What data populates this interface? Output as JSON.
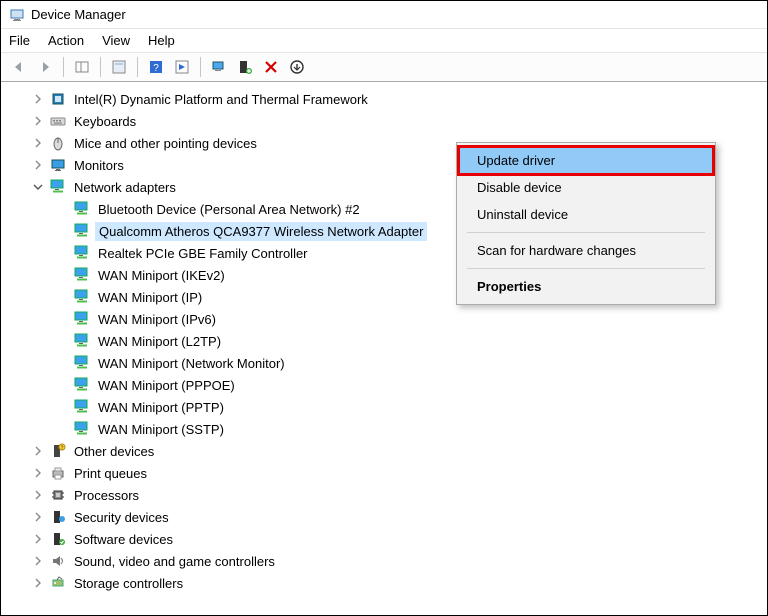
{
  "window": {
    "title": "Device Manager"
  },
  "menu": {
    "file": "File",
    "action": "Action",
    "view": "View",
    "help": "Help"
  },
  "tree": {
    "items": [
      {
        "expand": "closed",
        "icon": "intel",
        "label": "Intel(R) Dynamic Platform and Thermal Framework",
        "depth": 1
      },
      {
        "expand": "closed",
        "icon": "keyboard",
        "label": "Keyboards",
        "depth": 1
      },
      {
        "expand": "closed",
        "icon": "mouse",
        "label": "Mice and other pointing devices",
        "depth": 1
      },
      {
        "expand": "closed",
        "icon": "monitor",
        "label": "Monitors",
        "depth": 1
      },
      {
        "expand": "open",
        "icon": "monitor-net",
        "label": "Network adapters",
        "depth": 1
      },
      {
        "expand": "none",
        "icon": "monitor-net",
        "label": "Bluetooth Device (Personal Area Network) #2",
        "depth": 2
      },
      {
        "expand": "none",
        "icon": "monitor-net",
        "label": "Qualcomm Atheros QCA9377 Wireless Network Adapter",
        "depth": 2,
        "selected": true
      },
      {
        "expand": "none",
        "icon": "monitor-net",
        "label": "Realtek PCIe GBE Family Controller",
        "depth": 2
      },
      {
        "expand": "none",
        "icon": "monitor-net",
        "label": "WAN Miniport (IKEv2)",
        "depth": 2
      },
      {
        "expand": "none",
        "icon": "monitor-net",
        "label": "WAN Miniport (IP)",
        "depth": 2
      },
      {
        "expand": "none",
        "icon": "monitor-net",
        "label": "WAN Miniport (IPv6)",
        "depth": 2
      },
      {
        "expand": "none",
        "icon": "monitor-net",
        "label": "WAN Miniport (L2TP)",
        "depth": 2
      },
      {
        "expand": "none",
        "icon": "monitor-net",
        "label": "WAN Miniport (Network Monitor)",
        "depth": 2
      },
      {
        "expand": "none",
        "icon": "monitor-net",
        "label": "WAN Miniport (PPPOE)",
        "depth": 2
      },
      {
        "expand": "none",
        "icon": "monitor-net",
        "label": "WAN Miniport (PPTP)",
        "depth": 2
      },
      {
        "expand": "none",
        "icon": "monitor-net",
        "label": "WAN Miniport (SSTP)",
        "depth": 2
      },
      {
        "expand": "closed",
        "icon": "other",
        "label": "Other devices",
        "depth": 1
      },
      {
        "expand": "closed",
        "icon": "printer",
        "label": "Print queues",
        "depth": 1
      },
      {
        "expand": "closed",
        "icon": "cpu",
        "label": "Processors",
        "depth": 1
      },
      {
        "expand": "closed",
        "icon": "security",
        "label": "Security devices",
        "depth": 1
      },
      {
        "expand": "closed",
        "icon": "software",
        "label": "Software devices",
        "depth": 1
      },
      {
        "expand": "closed",
        "icon": "sound",
        "label": "Sound, video and game controllers",
        "depth": 1
      },
      {
        "expand": "closed",
        "icon": "storage",
        "label": "Storage controllers",
        "depth": 1
      }
    ]
  },
  "context_menu": {
    "update": "Update driver",
    "disable": "Disable device",
    "uninstall": "Uninstall device",
    "scan": "Scan for hardware changes",
    "properties": "Properties"
  }
}
